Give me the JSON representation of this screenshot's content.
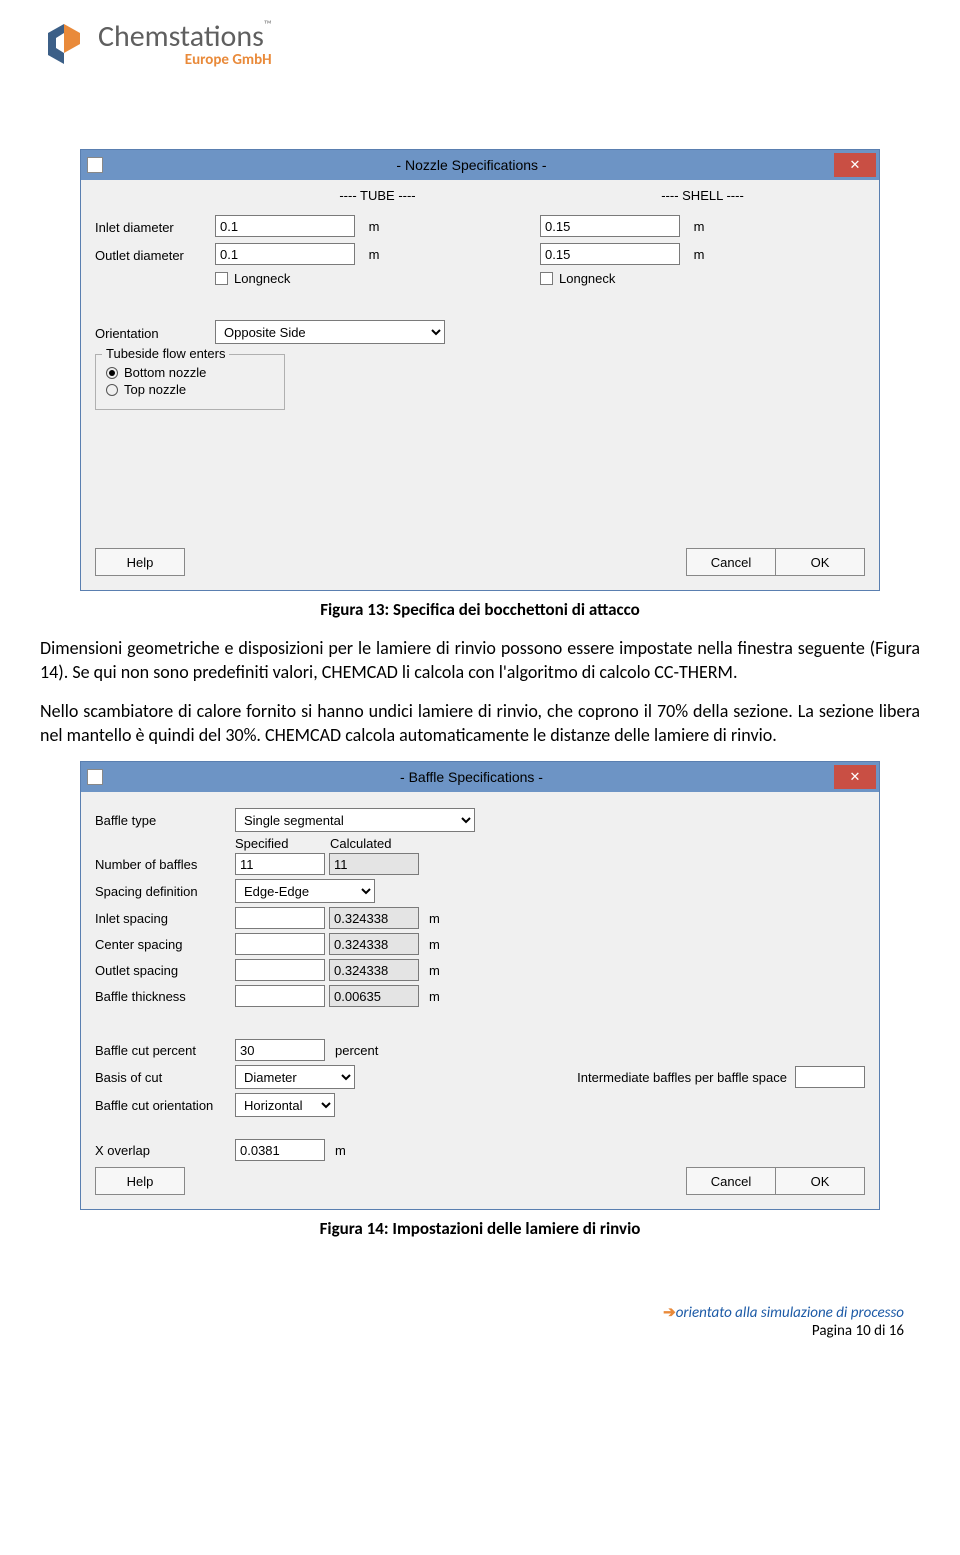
{
  "logo": {
    "name": "Chemstations",
    "sub": "Europe GmbH"
  },
  "caption1": "Figura 13: Specifica dei bocchettoni di attacco",
  "para1": "Dimensioni geometriche e disposizioni per le lamiere di rinvio possono essere impostate nella finestra seguente (Figura 14). Se qui non sono predefiniti valori, CHEMCAD li calcola con l'algoritmo di calcolo CC-THERM.",
  "para2": "Nello scambiatore di calore fornito si hanno undici lamiere di rinvio, che coprono il 70% della sezione. La sezione libera nel mantello è quindi del 30%. CHEMCAD calcola automaticamente le distanze delle lamiere di rinvio.",
  "caption2": "Figura 14: Impostazioni delle lamiere di rinvio",
  "footer": {
    "tagline": "orientato alla simulazione  di processo",
    "page": "Pagina 10 di 16"
  },
  "dlg1": {
    "title": "- Nozzle Specifications -",
    "tubeHdr": "---- TUBE ----",
    "shellHdr": "---- SHELL ----",
    "inletLabel": "Inlet diameter",
    "outletLabel": "Outlet diameter",
    "orientationLabel": "Orientation",
    "tube": {
      "inlet": "0.1",
      "outlet": "0.1",
      "longneck": "Longneck"
    },
    "shell": {
      "inlet": "0.15",
      "outlet": "0.15",
      "longneck": "Longneck"
    },
    "orientation": "Opposite Side",
    "groupTitle": "Tubeside flow enters",
    "opt1": "Bottom nozzle",
    "opt2": "Top nozzle",
    "unit": "m",
    "help": "Help",
    "cancel": "Cancel",
    "ok": "OK"
  },
  "dlg2": {
    "title": "- Baffle Specifications -",
    "labels": {
      "baffleType": "Baffle type",
      "specified": "Specified",
      "calculated": "Calculated",
      "numBaffles": "Number of baffles",
      "spacingDef": "Spacing definition",
      "inletSpacing": "Inlet spacing",
      "centerSpacing": "Center spacing",
      "outletSpacing": "Outlet spacing",
      "baffleThick": "Baffle thickness",
      "cutPercent": "Baffle cut percent",
      "basisCut": "Basis of cut",
      "cutOrient": "Baffle cut orientation",
      "xOverlap": "X overlap",
      "intermBaffles": "Intermediate baffles per baffle space"
    },
    "vals": {
      "baffleType": "Single segmental",
      "numBafflesSpec": "11",
      "numBafflesCalc": "11",
      "spacingDef": "Edge-Edge",
      "inletCalc": "0.324338",
      "centerCalc": "0.324338",
      "outletCalc": "0.324338",
      "thickCalc": "0.00635",
      "cutPercent": "30",
      "cutPercentUnit": "percent",
      "basisCut": "Diameter",
      "cutOrient": "Horizontal",
      "xOverlap": "0.0381"
    },
    "unit": "m",
    "help": "Help",
    "cancel": "Cancel",
    "ok": "OK"
  }
}
